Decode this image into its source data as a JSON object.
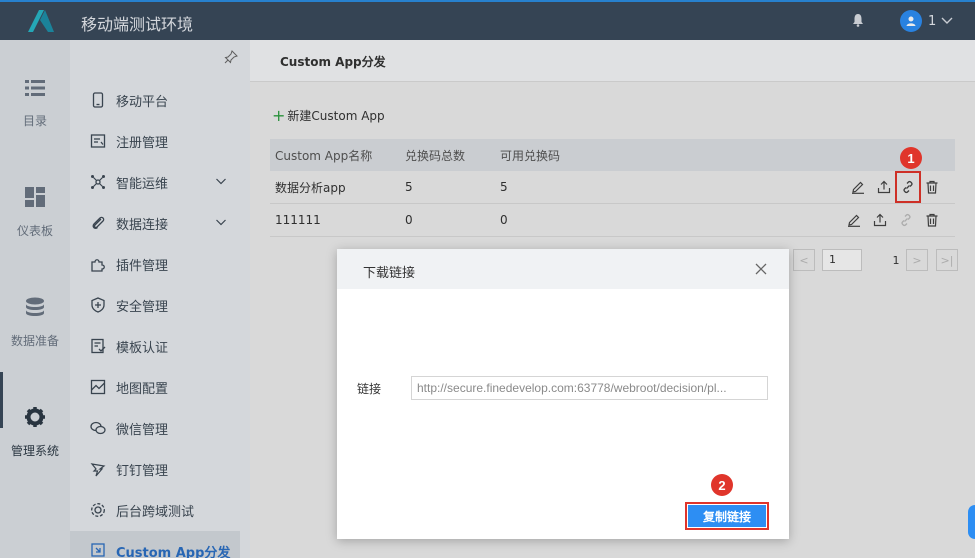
{
  "app": {
    "title": "移动端测试环境",
    "user": "1"
  },
  "rail": [
    {
      "label": "目录",
      "icon": "list-icon"
    },
    {
      "label": "仪表板",
      "icon": "dashboard-icon"
    },
    {
      "label": "数据准备",
      "icon": "database-icon"
    },
    {
      "label": "管理系统",
      "icon": "gear-icon",
      "active": true
    }
  ],
  "menu": [
    {
      "label": "移动平台",
      "icon": "mobile-icon"
    },
    {
      "label": "注册管理",
      "icon": "register-icon"
    },
    {
      "label": "智能运维",
      "icon": "ops-icon",
      "expandable": true
    },
    {
      "label": "数据连接",
      "icon": "link-icon",
      "expandable": true
    },
    {
      "label": "插件管理",
      "icon": "plugin-icon"
    },
    {
      "label": "安全管理",
      "icon": "shield-icon"
    },
    {
      "label": "模板认证",
      "icon": "template-icon"
    },
    {
      "label": "地图配置",
      "icon": "map-icon"
    },
    {
      "label": "微信管理",
      "icon": "wechat-icon"
    },
    {
      "label": "钉钉管理",
      "icon": "dingtalk-icon"
    },
    {
      "label": "后台跨域测试",
      "icon": "settings-icon"
    },
    {
      "label": "Custom App分发",
      "icon": "custom-app-icon",
      "active": true
    }
  ],
  "page": {
    "breadcrumb": "Custom App分发",
    "new_button": "新建Custom App",
    "table": {
      "columns": [
        "Custom App名称",
        "兑换码总数",
        "可用兑换码"
      ],
      "rows": [
        [
          "数据分析app",
          "5",
          "5"
        ],
        [
          "111111",
          "0",
          "0"
        ]
      ]
    },
    "pager": {
      "current": "1",
      "total": "1"
    }
  },
  "dialog": {
    "title": "下载链接",
    "link_label": "链接",
    "link_value": "http://secure.finedevelop.com:63778/webroot/decision/pl...",
    "copy_button": "复制链接"
  },
  "annotations": [
    "1",
    "2"
  ],
  "colors": {
    "topbar": "#3a4a5c",
    "primary": "#2d8ef3",
    "highlight": "#e0352b",
    "add": "#2d9e41"
  }
}
